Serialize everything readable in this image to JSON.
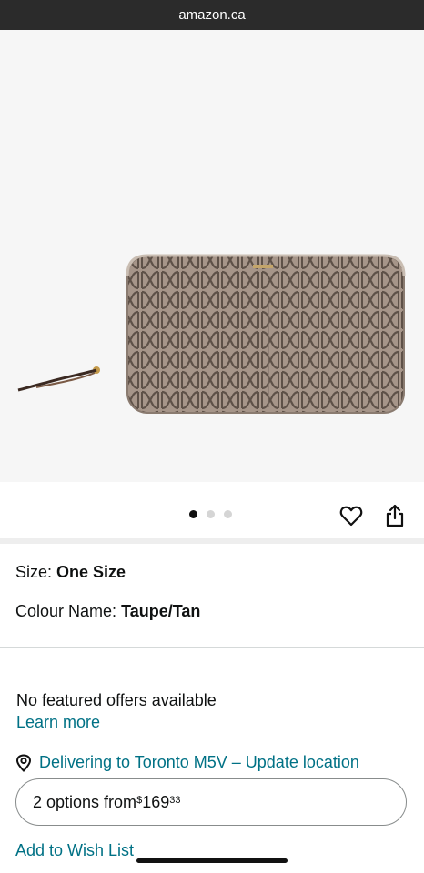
{
  "browser": {
    "url_text": "amazon.ca"
  },
  "gallery": {
    "product_image": "wallet-image",
    "dots": [
      {
        "active": true
      },
      {
        "active": false
      },
      {
        "active": false
      }
    ],
    "wishlist_icon": "heart-icon",
    "share_icon": "share-icon"
  },
  "attributes": {
    "size_label": "Size:",
    "size_value": "One Size",
    "colour_label": "Colour Name:",
    "colour_value": "Taupe/Tan"
  },
  "offers": {
    "no_offers_text": "No featured offers available",
    "learn_more": "Learn more"
  },
  "delivery": {
    "icon": "location-pin-icon",
    "text": "Delivering to Toronto M5V – Update location"
  },
  "buying_options": {
    "prefix": "2 options from ",
    "currency": "$",
    "price_whole": "169",
    "price_fraction": "33"
  },
  "wish_list": {
    "label": "Add to Wish List"
  },
  "colors": {
    "link": "#007185",
    "urlbar": "#2b2b2b",
    "wallet_base": "#a69589",
    "wallet_pattern": "#5e5148"
  }
}
